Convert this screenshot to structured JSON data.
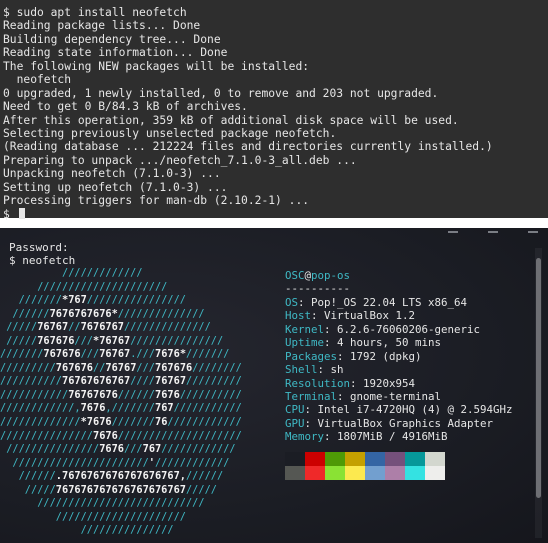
{
  "terminal_top": {
    "lines": [
      "$ sudo apt install neofetch",
      "Reading package lists... Done",
      "Building dependency tree... Done",
      "Reading state information... Done",
      "The following NEW packages will be installed:",
      "  neofetch",
      "0 upgraded, 1 newly installed, 0 to remove and 203 not upgraded.",
      "Need to get 0 B/84.3 kB of archives.",
      "After this operation, 359 kB of additional disk space will be used.",
      "Selecting previously unselected package neofetch.",
      "(Reading database ... 212224 files and directories currently installed.)",
      "Preparing to unpack .../neofetch_7.1.0-3_all.deb ...",
      "Unpacking neofetch (7.1.0-3) ...",
      "Setting up neofetch (7.1.0-3) ...",
      "Processing triggers for man-db (2.10.2-1) ..."
    ],
    "prompt": "$"
  },
  "terminal_bottom": {
    "password_line": "Password:",
    "command_line": "$ neofetch",
    "user": "OSC",
    "at": "@",
    "host": "pop-os",
    "separator": "----------",
    "info": [
      {
        "key": "OS",
        "value": ": Pop!_OS 22.04 LTS x86_64"
      },
      {
        "key": "Host",
        "value": ": VirtualBox 1.2"
      },
      {
        "key": "Kernel",
        "value": ": 6.2.6-76060206-generic"
      },
      {
        "key": "Uptime",
        "value": ": 4 hours, 50 mins"
      },
      {
        "key": "Packages",
        "value": ": 1792 (dpkg)"
      },
      {
        "key": "Shell",
        "value": ": sh"
      },
      {
        "key": "Resolution",
        "value": ": 1920x954"
      },
      {
        "key": "Terminal",
        "value": ": gnome-terminal"
      },
      {
        "key": "CPU",
        "value": ": Intel i7-4720HQ (4) @ 2.594GHz"
      },
      {
        "key": "GPU",
        "value": ": VirtualBox Graphics Adapter"
      },
      {
        "key": "Memory",
        "value": ": 1807MiB / 4916MiB"
      }
    ],
    "palette_row1": [
      "#1b1d24",
      "#cc0000",
      "#4e9a06",
      "#c4a000",
      "#3465a4",
      "#75507b",
      "#06989a",
      "#d3d7cf"
    ],
    "palette_row2": [
      "#555753",
      "#ef2929",
      "#8ae234",
      "#fce94f",
      "#729fcf",
      "#ad7fa8",
      "#34e2e2",
      "#eeeeec"
    ],
    "logo_color": "#3fb9c5"
  }
}
